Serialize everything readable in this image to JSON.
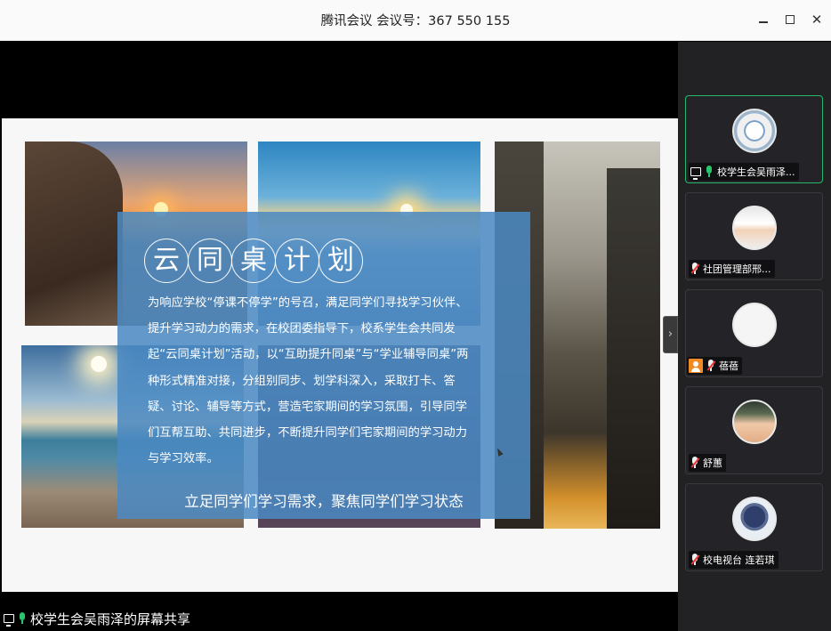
{
  "window": {
    "title": "腾讯会议 会议号：367 550 155",
    "controls": [
      "minimize",
      "maximize",
      "close"
    ]
  },
  "slide": {
    "heading_chars": [
      "云",
      "同",
      "桌",
      "计",
      "划"
    ],
    "paragraph": "为响应学校“停课不停学”的号召，满足同学们寻找学习伙伴、提升学习动力的需求，在校团委指导下，校系学生会共同发起“云同桌计划”活动，以“互助提升同桌”与“学业辅导同桌”两种形式精准对接，分组别同步、划学科深入，采取打卡、答疑、讨论、辅导等方式，营造宅家期间的学习氛围，引导同学们互帮互助、共同进步，不断提升同学们宅家期间的学习动力与学习效率。",
    "slogan": "立足同学们学习需求，聚焦同学们学习状态"
  },
  "share_label": "校学生会吴雨泽的屏幕共享",
  "collapse_arrow": "›",
  "participants": [
    {
      "name": "校学生会吴雨泽...",
      "mic": "on",
      "sharing": true,
      "active": true
    },
    {
      "name": "社团管理部邢...",
      "mic": "muted"
    },
    {
      "name": "蓓蓓",
      "mic": "muted",
      "badge": "person"
    },
    {
      "name": "舒蕙",
      "mic": "muted"
    },
    {
      "name": "校电视台 连若琪",
      "mic": "muted"
    }
  ],
  "colors": {
    "overlay": "#4a89c3",
    "active_border": "#27b76b",
    "mic_on": "#29c46c",
    "mic_muted_slash": "#e33333",
    "panel_bg": "#222225"
  }
}
